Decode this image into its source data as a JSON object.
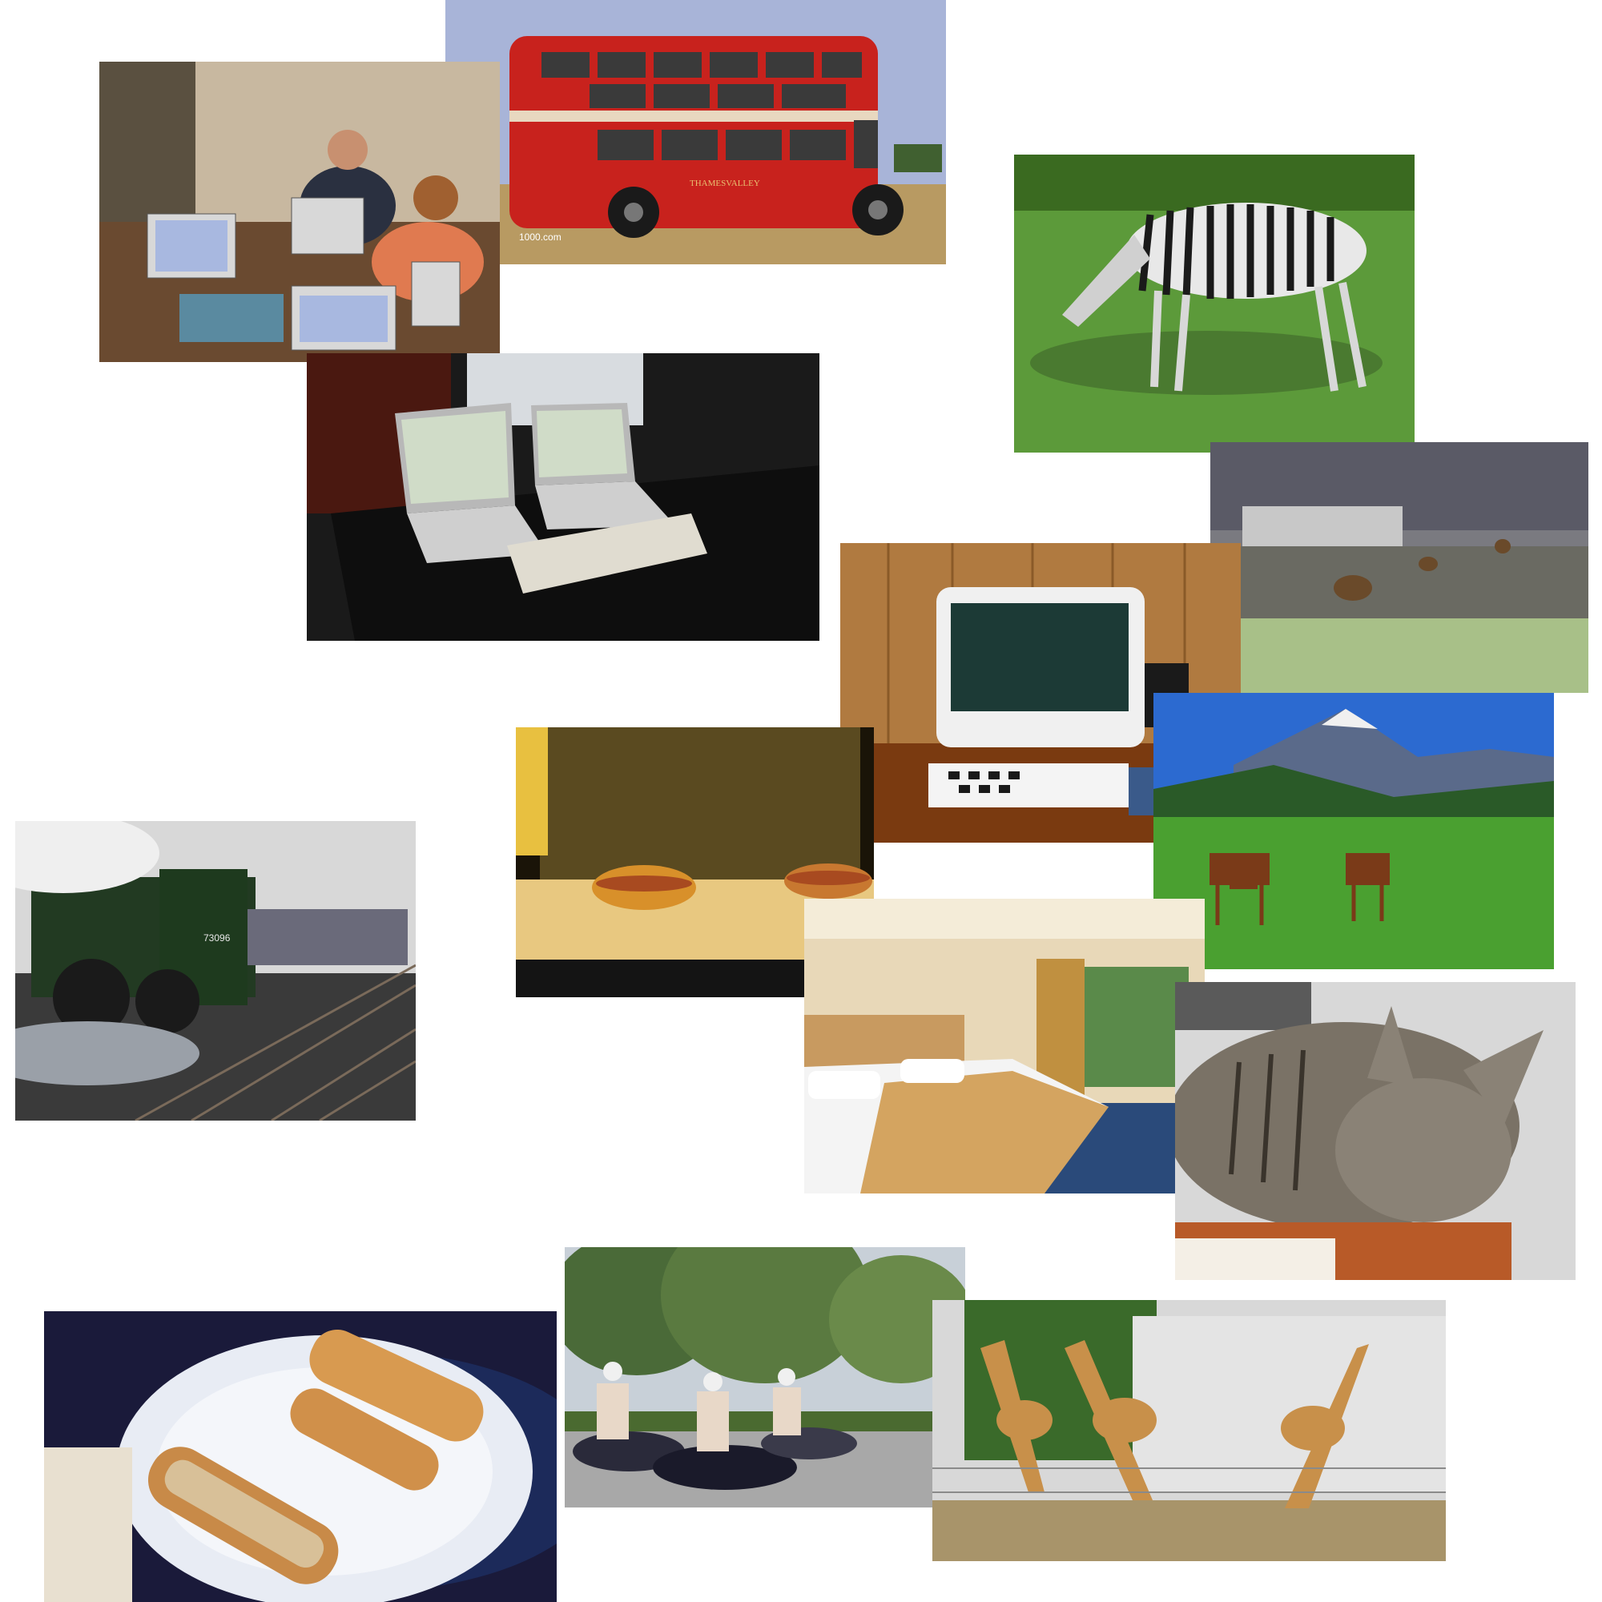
{
  "canvas": {
    "background": "#ffffff"
  },
  "photos": [
    {
      "id": "bus",
      "subject": "red double-decker bus",
      "caption_visible": "THAMESVALLEY",
      "watermark": "1000.com"
    },
    {
      "id": "laptop-party",
      "subject": "people with laptops at a table"
    },
    {
      "id": "zebra",
      "subject": "grazing zebra"
    },
    {
      "id": "desk-laptops",
      "subject": "two laptops and keyboard on desk"
    },
    {
      "id": "bears",
      "subject": "bears in a river"
    },
    {
      "id": "imac",
      "subject": "computer on wooden desk"
    },
    {
      "id": "hotdogs",
      "subject": "two hot dogs on display"
    },
    {
      "id": "horses",
      "subject": "horses with mountains"
    },
    {
      "id": "train",
      "subject": "steam locomotive",
      "number": "73096"
    },
    {
      "id": "hotel",
      "subject": "hotel room with beds"
    },
    {
      "id": "cat",
      "subject": "sleeping tabby cat"
    },
    {
      "id": "sandwich",
      "subject": "sandwiches on plate"
    },
    {
      "id": "scooters",
      "subject": "people riding scooters"
    },
    {
      "id": "giraffes",
      "subject": "three giraffes"
    }
  ]
}
